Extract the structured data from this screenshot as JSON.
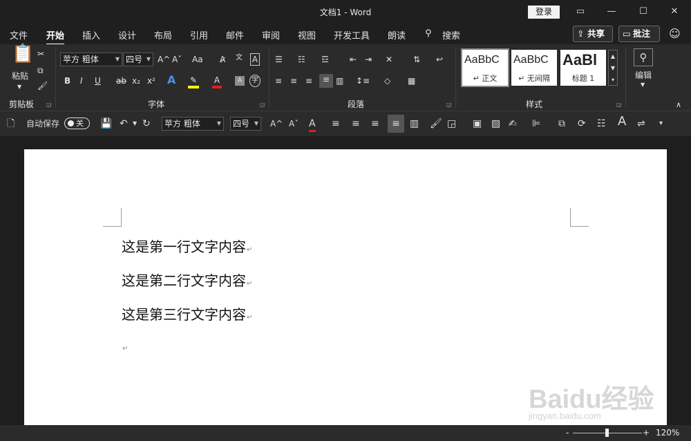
{
  "window": {
    "title": "文档1  -  Word",
    "login_label": "登录",
    "controls": {
      "ribbon_display": "▭",
      "minimize": "—",
      "maximize": "☐",
      "close": "✕"
    }
  },
  "tabs": [
    "文件",
    "开始",
    "插入",
    "设计",
    "布局",
    "引用",
    "邮件",
    "审阅",
    "视图",
    "开发工具",
    "朗读"
  ],
  "active_tab": "开始",
  "search_label": "搜索",
  "share_label": "共享",
  "comment_label": "批注",
  "ribbon": {
    "clipboard": {
      "paste_label": "粘贴",
      "group_label": "剪贴板"
    },
    "font": {
      "font_name": "苹方 粗体",
      "font_size": "四号",
      "group_label": "字体",
      "icons": {
        "grow": "A^",
        "shrink": "Aˇ",
        "case": "Aa",
        "bold": "B",
        "italic": "I",
        "underline": "U",
        "strike": "ab",
        "subscript": "x₂",
        "superscript": "x²",
        "effects": "A",
        "font_color": "A"
      }
    },
    "paragraph": {
      "group_label": "段落"
    },
    "styles": {
      "group_label": "样式",
      "items": [
        {
          "preview": "AaBbC",
          "name": "↵ 正文"
        },
        {
          "preview": "AaBbC",
          "name": "↵ 无间隔"
        },
        {
          "preview": "AaBl",
          "name": "标题 1"
        }
      ]
    },
    "editing": {
      "label": "编辑"
    }
  },
  "qat": {
    "autosave_label": "自动保存",
    "autosave_state": "关",
    "font_name": "苹方 粗体",
    "font_size": "四号"
  },
  "document": {
    "lines": [
      "这是第一行文字内容",
      "这是第二行文字内容",
      "这是第三行文字内容"
    ],
    "paragraph_mark": "↵"
  },
  "watermark": {
    "brand": "Baidu经验",
    "url": "jingyan.baidu.com"
  },
  "status": {
    "zoom_minus": "-",
    "zoom_plus": "+",
    "zoom": "120%"
  }
}
